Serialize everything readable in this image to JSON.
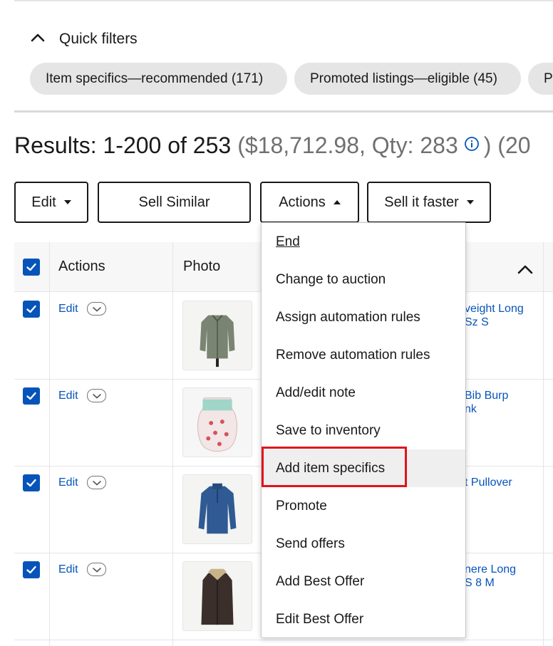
{
  "quick_filters": {
    "title": "Quick filters",
    "chips": [
      "Item specifics—recommended (171)",
      "Promoted listings—eligible (45)",
      "P"
    ]
  },
  "results": {
    "range": "Results: 1-200 of 253",
    "summary": "($18,712.98, Qty: 283",
    "suffix": ") (20"
  },
  "toolbar": {
    "edit": "Edit",
    "sell_similar": "Sell Similar",
    "actions": "Actions",
    "sell_faster": "Sell it faster"
  },
  "table": {
    "headers": {
      "actions": "Actions",
      "photo": "Photo"
    },
    "rows": [
      {
        "edit": "Edit",
        "title_line1": "veight Long",
        "title_line2": "Sz S"
      },
      {
        "edit": "Edit",
        "title_line1": "Bib Burp",
        "title_line2": "nk"
      },
      {
        "edit": "Edit",
        "title_line1": "t Pullover",
        "title_line2": ""
      },
      {
        "edit": "Edit",
        "title_line1": "nere Long",
        "title_line2": "S 8 M"
      }
    ]
  },
  "actions_menu": {
    "items": [
      "End",
      "Change to auction",
      "Assign automation rules",
      "Remove automation rules",
      "Add/edit note",
      "Save to inventory",
      "Add item specifics",
      "Promote",
      "Send offers",
      "Add Best Offer",
      "Edit Best Offer"
    ],
    "highlighted_item": "Add item specifics"
  },
  "colors": {
    "link": "#0654ba",
    "checkbox": "#0654ba",
    "highlight": "#e0141c",
    "chip_bg": "#e5e5e5"
  }
}
